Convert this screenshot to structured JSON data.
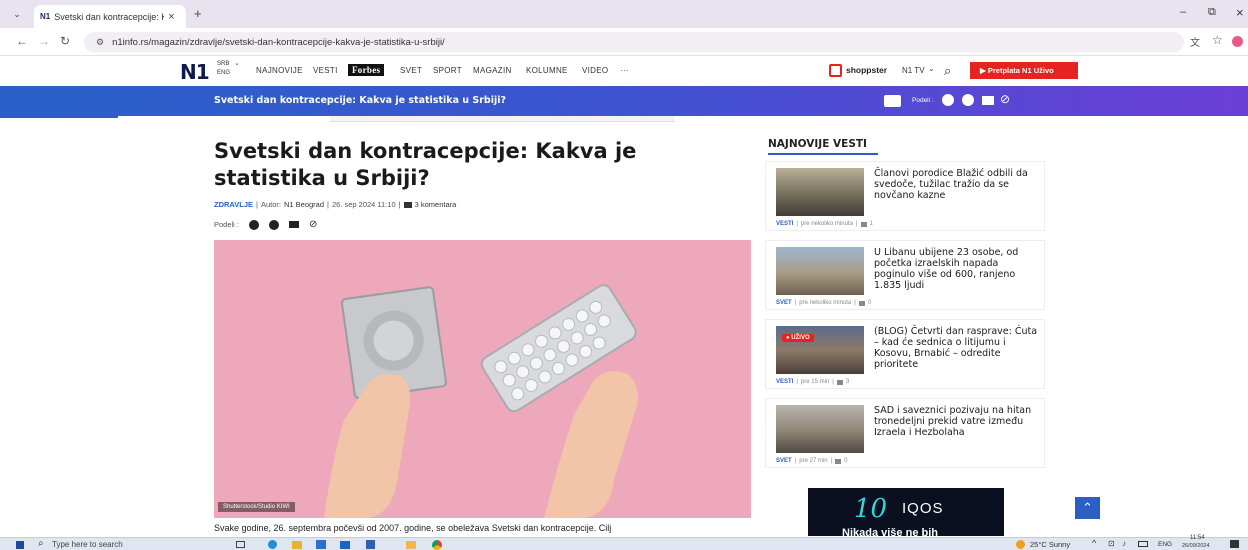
{
  "browser": {
    "tab_title": "Svetski dan kontracepcije: Kakv",
    "tab_close": "×",
    "new_tab": "+",
    "url": "n1info.rs/magazin/zdravlje/svetski-dan-kontracepcije-kakva-je-statistika-u-srbiji/",
    "minimize": "–",
    "restore": "⧉",
    "close": "×"
  },
  "site": {
    "logo": "N1",
    "lang_active": "SRB",
    "lang_other": "ENG",
    "nav": [
      "NAJNOVIJE",
      "VESTI",
      "Forbes",
      "SVET",
      "SPORT",
      "MAGAZIN",
      "KOLUMNE",
      "VIDEO",
      "···"
    ],
    "shoppster": "shoppster",
    "n1tv": "N1 TV",
    "live_button": "▶ Pretplata N1 Uživo"
  },
  "banner": {
    "title": "Svetski dan kontracepcije: Kakva je statistika u Srbiji?",
    "share_label": "Podeli :"
  },
  "article": {
    "title": "Svetski dan kontracepcije: Kakva je statistika u Srbiji?",
    "category": "ZDRAVLJE",
    "author_label": "Autor:",
    "author": "N1 Beograd",
    "date": "26. sep 2024 11:10",
    "comments": "3 komentara",
    "share_label": "Podeli :",
    "photo_credit": "Shutterstock/Studio KIWI",
    "lead": "Svake godine, 26. septembra počevši od 2007. godine, se obeležava Svetski dan kontracepcije. Cilj"
  },
  "sidebar": {
    "title": "NAJNOVIJE VESTI",
    "items": [
      {
        "title": "Članovi porodice Blažić odbili da svedoče, tužilac tražio da se novčano kazne",
        "category": "VESTI",
        "time": "pre nekoliko minuta",
        "comments": "1"
      },
      {
        "title": "U Libanu ubijene 23 osobe, od početka izraelskih napada poginulo više od 600, ranjeno 1.835 ljudi",
        "category": "SVET",
        "time": "pre nekoliko minuta",
        "comments": "0"
      },
      {
        "title": "(BLOG) Četvrti dan rasprave: Ćuta – kad će sednica o litijumu i Kosovu, Brnabić – odredite prioritete",
        "category": "VESTI",
        "time": "pre 15 min",
        "comments": "3",
        "badge": "● UŽIVO"
      },
      {
        "title": "SAD i saveznici pozivaju na hitan tronedeljni prekid vatre između Izraela i Hezbolaha",
        "category": "SVET",
        "time": "pre 27 min",
        "comments": "0"
      }
    ]
  },
  "ad": {
    "text": "IQOS",
    "number": "10",
    "sub": "Nikada više ne bih"
  },
  "taskbar": {
    "search_placeholder": "Type here to search",
    "weather": "25°C Sunny",
    "lang": "ENG",
    "time": "11:54",
    "date": "26/09/2024"
  },
  "colors": {
    "accent": "#2c5fc4",
    "live_red": "#e52420",
    "banner_start": "#2a61c8",
    "banner_end": "#6b3fd6"
  }
}
